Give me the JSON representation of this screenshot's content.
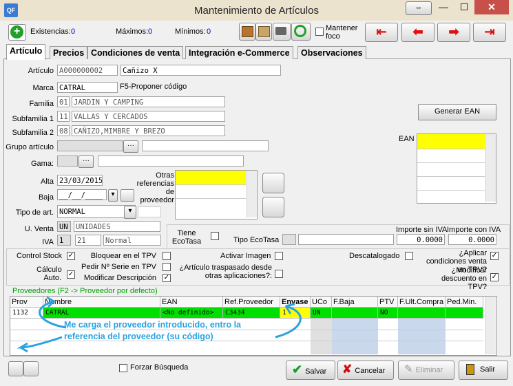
{
  "window": {
    "title": "Mantenimiento de Artículos",
    "icon_text": "QF"
  },
  "toolbar": {
    "existencias_label": "Existencias:",
    "existencias_value": "0",
    "maximos_label": "Máximos:",
    "maximos_value": "0",
    "minimos_label": "Mínimos:",
    "minimos_value": "0",
    "mantener_foco_label": "Mantener foco"
  },
  "tabs": [
    "Artículo",
    "Precios",
    "Condiciones de venta",
    "Integración e-Commerce",
    "Observaciones"
  ],
  "form": {
    "articulo_label": "Artículo",
    "articulo_code": "A000000002",
    "articulo_desc": "Cañizo X",
    "marca_label": "Marca",
    "marca_value": "CATRAL",
    "proponer_label": "F5-Proponer código",
    "familia_label": "Familia",
    "familia_code": "01",
    "familia_desc": "JARDIN Y CAMPING",
    "subfamilia1_label": "Subfamilia 1",
    "subfamilia1_code": "11",
    "subfamilia1_desc": "VALLAS Y CERCADOS",
    "subfamilia2_label": "Subfamilia 2",
    "subfamilia2_code": "08",
    "subfamilia2_desc": "CAÑIZO,MIMBRE Y BREZO",
    "grupo_label": "Grupo artículo",
    "gama_label": "Gama:",
    "alta_label": "Alta",
    "alta_value": "23/03/2015",
    "baja_label": "Baja",
    "baja_value": "__/__/____",
    "tipo_label": "Tipo de art.",
    "tipo_value": "NORMAL",
    "uventa_label": "U. Venta",
    "uventa_code": "UN",
    "uventa_desc": "UNIDADES",
    "iva_label": "IVA",
    "iva_code": "1",
    "iva_pct": "21",
    "iva_desc": "Normal",
    "otras_ref_label": "Otras referencias de proveedor",
    "generar_ean_label": "Generar EAN",
    "ean_label": "EAN",
    "tiene_ecotasa_label": "Tiene EcoTasa",
    "tipo_ecotasa_label": "Tipo EcoTasa",
    "importe_sin_iva_label": "Importe sin IVA",
    "importe_sin_iva_value": "0.0000",
    "importe_con_iva_label": "Importe con IVA",
    "importe_con_iva_value": "0.0000"
  },
  "checks": {
    "control_stock": "Control Stock",
    "calculo_auto": "Cálculo Auto.",
    "bloquear_tpv": "Bloquear en el TPV",
    "pedir_serie": "Pedir Nº Serie en TPV",
    "modificar_desc": "Modificar Descripción",
    "activar_imagen": "Activar Imagen",
    "traspasado": "¿Artículo traspasado desde otras aplicaciones?:",
    "descatalogado": "Descatalogado",
    "aplicar_cond": "¿Aplicar condiciones venta en TPV?",
    "modificar_dto": "¿Modificar descuento en TPV?",
    "check_mark": "✓"
  },
  "proveedores": {
    "title": "Proveedores (F2 -> Proveedor por defecto)",
    "columns": [
      "Prov",
      "Nombre",
      "EAN",
      "Ref.Proveedor",
      "Envase",
      "UCo",
      "F.Baja",
      "PTV",
      "F.Ult.Compra",
      "Ped.Min."
    ],
    "row": [
      "1132",
      "CATRAL",
      "<No definido>",
      "C3434",
      "1",
      "UN",
      "",
      "NO",
      "",
      ""
    ]
  },
  "annotation": "Me carga el proveedor introducido, entro la referencia del proveedor (su código)",
  "bottom": {
    "forzar_busqueda": "Forzar Búsqueda",
    "salvar": "Salvar",
    "cancelar": "Cancelar",
    "eliminar": "Eliminar",
    "salir": "Salir"
  },
  "colors": {
    "highlight_green": "#00e000",
    "highlight_yellow": "#ffff00",
    "annotation_blue": "#29a3e0",
    "nav_red": "#e01010"
  }
}
